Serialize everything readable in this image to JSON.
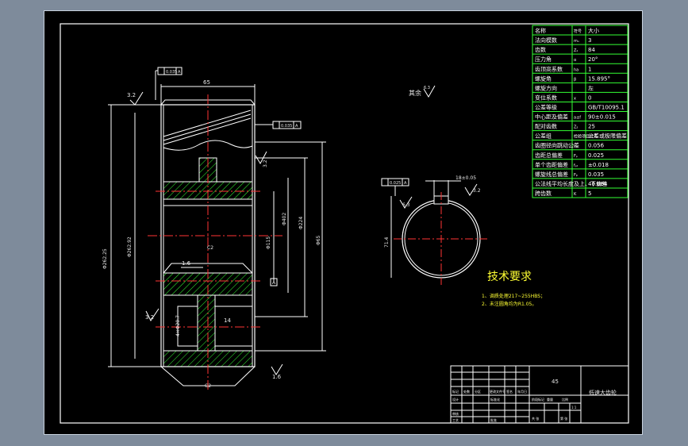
{
  "colors": {
    "background": "#7e8b9b",
    "paper": "#000000",
    "frame": "#ffffff",
    "table_lines": "#33ff33",
    "center_lines": "#ff3333",
    "hatch": "#33ff33",
    "dim_lines": "#ffffff",
    "text_yellow": "#ffff33"
  },
  "table": {
    "header": {
      "name": "名称",
      "symbol": "符号",
      "value": "大小"
    },
    "rows": [
      {
        "name": "法向模数",
        "symbol": "mₙ",
        "value": "3"
      },
      {
        "name": "齿数",
        "symbol": "Z₁",
        "value": "84"
      },
      {
        "name": "压力角",
        "symbol": "α",
        "value": "20°"
      },
      {
        "name": "齿顶高系数",
        "symbol": "ha",
        "value": "1"
      },
      {
        "name": "螺旋角",
        "symbol": "β",
        "value": "15.895°"
      },
      {
        "name": "螺旋方向",
        "symbol": "",
        "value": "左"
      },
      {
        "name": "变位系数",
        "symbol": "x",
        "value": "0"
      },
      {
        "name": "公差等级",
        "symbol": "",
        "value": "GB/T10095.1"
      },
      {
        "name": "中心距及偏差",
        "symbol": "a±f",
        "value": "90±0.015"
      },
      {
        "name": "配对齿数",
        "symbol": "Z₂",
        "value": "25"
      },
      {
        "name": "公差组",
        "symbol": "检验项目代号",
        "value": "公差或极限偏差"
      },
      {
        "name": "齿圈径向跳动公差",
        "symbol": "Fᵣ",
        "value": "0.056"
      },
      {
        "name": "齿距总偏差",
        "symbol": "Fₚ",
        "value": "0.025"
      },
      {
        "name": "单个齿距偏差",
        "symbol": "fₚₜ",
        "value": "±0.018"
      },
      {
        "name": "螺旋线总偏差",
        "symbol": "Fᵦ",
        "value": "0.035"
      },
      {
        "name": "公法线平均长度及上、下偏差",
        "symbol": "",
        "value": "40.064"
      },
      {
        "name": "跨齿数",
        "symbol": "K",
        "value": "5"
      }
    ]
  },
  "front_view": {
    "width_dim": "65",
    "roughness_top_left": "3.2",
    "roughness_bottom_left": "3.2",
    "roughness_bore": "3.2",
    "roughness_bottom": "1.6",
    "roughness_web": "1.6",
    "gdt_top": [
      "",
      "0.035",
      "A"
    ],
    "gdt_side": [
      "",
      "0.035",
      "A"
    ],
    "dia_outer": "Φ262.25",
    "dia_pitch": "Φ262.92",
    "dia_hub": "Φ115",
    "dia_web_in": "Φ402",
    "dia_web_out": "Φ224",
    "dia_bore": "Φ65",
    "chamfer_top": "C2",
    "chamfer_bottom": "C2",
    "holes": "4×Φ20.7",
    "web_thick": "14",
    "datum": "A"
  },
  "side_view": {
    "keyway_width": "18±0.05",
    "keyway_depth": "71.4",
    "roughness": "3.2",
    "roughness_side": "6.3",
    "gdt": [
      "",
      "0.025",
      "A"
    ]
  },
  "notes": {
    "heading": "技术要求",
    "lines": [
      "1、调质处理217~255HBS；",
      "2、未注圆角均为R1.05。"
    ]
  },
  "title_block": {
    "material": "45",
    "drawing_name": "低速大齿轮",
    "scale": "1:1",
    "labels": [
      "标记",
      "处数",
      "分区",
      "更改文件号",
      "签名",
      "年月日",
      "设计",
      "标准化",
      "审核",
      "工艺",
      "批准",
      "阶段标记",
      "重量",
      "比例",
      "共 张",
      "第 张"
    ]
  },
  "other_mark": {
    "text": "其余",
    "roughness": "6.3"
  }
}
